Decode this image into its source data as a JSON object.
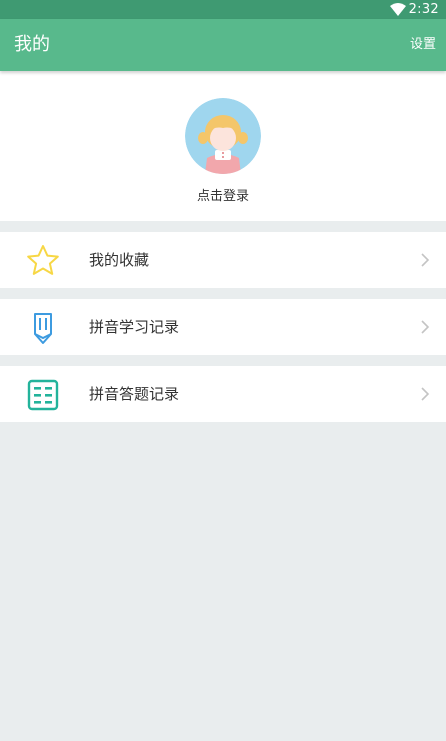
{
  "status_bar": {
    "time": "2:32",
    "wifi_icon": "wifi-icon"
  },
  "app_bar": {
    "title": "我的",
    "settings_label": "设置",
    "color": "#58b98c"
  },
  "profile": {
    "login_text": "点击登录",
    "avatar_icon": "girl-avatar"
  },
  "menu": {
    "items": [
      {
        "label": "我的收藏",
        "icon": "star-icon"
      },
      {
        "label": "拼音学习记录",
        "icon": "pencil-icon"
      },
      {
        "label": "拼音答题记录",
        "icon": "list-icon"
      }
    ]
  }
}
